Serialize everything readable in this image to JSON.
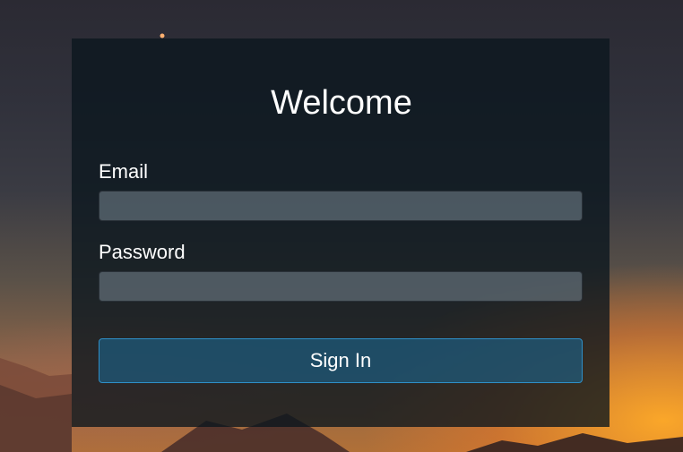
{
  "login": {
    "title": "Welcome",
    "email_label": "Email",
    "email_value": "",
    "password_label": "Password",
    "password_value": "",
    "sign_in_label": "Sign In"
  },
  "colors": {
    "panel_background": "#0a161e",
    "button_border": "#2e8fc8",
    "button_fill": "#1c648c",
    "text": "#ffffff"
  }
}
